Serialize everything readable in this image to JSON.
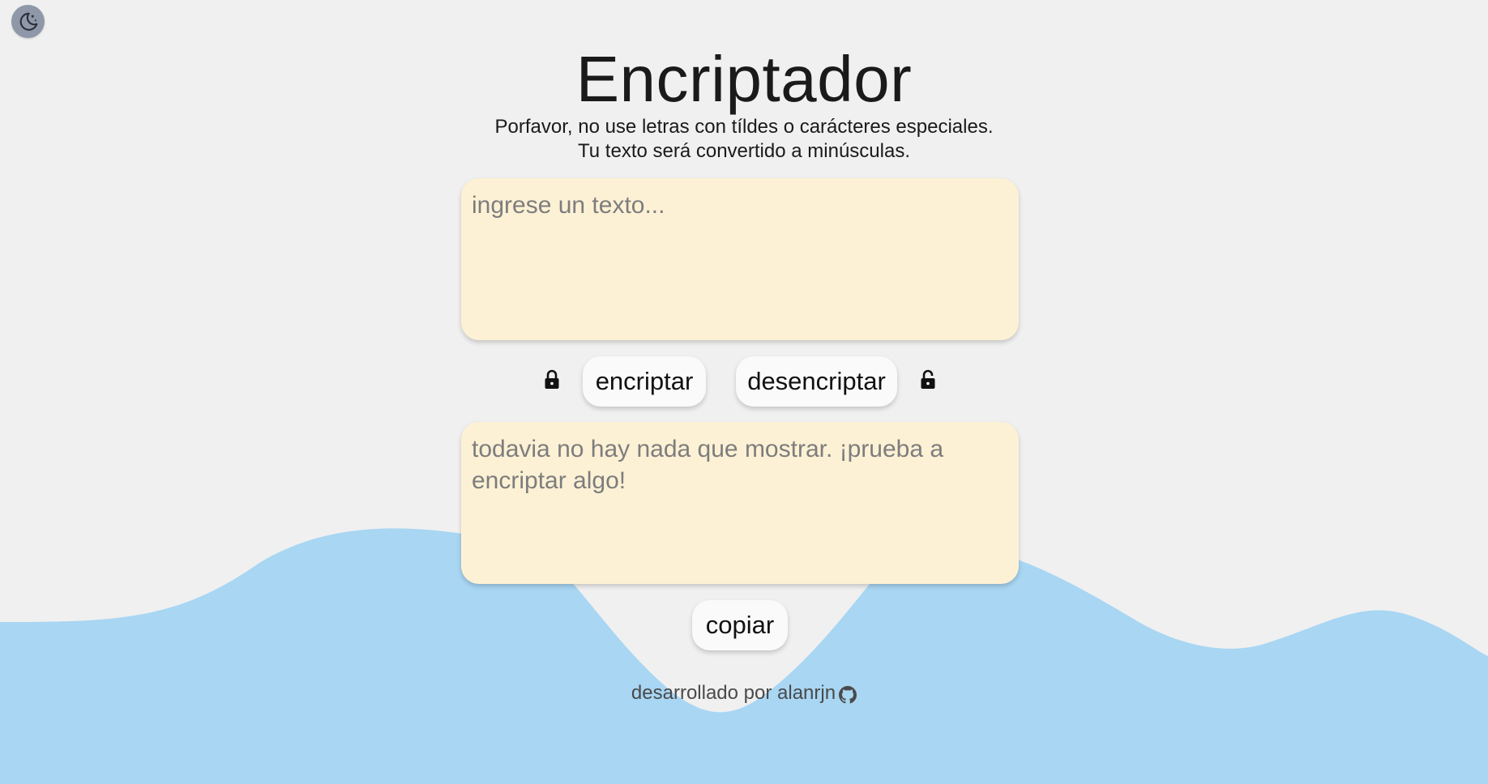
{
  "theme_toggle": {
    "icon": "moon-stars-icon"
  },
  "header": {
    "title": "Encriptador",
    "subtitle_line1": "Porfavor, no use letras con tíldes o carácteres especiales.",
    "subtitle_line2": "Tu texto será convertido a minúsculas."
  },
  "input": {
    "value": "",
    "placeholder": "ingrese un texto..."
  },
  "actions": {
    "encrypt_label": "encriptar",
    "decrypt_label": "desencriptar",
    "encrypt_icon": "lock-icon",
    "decrypt_icon": "unlock-icon"
  },
  "output": {
    "value": "",
    "placeholder": "todavia no hay nada que mostrar. ¡prueba a encriptar algo!"
  },
  "copy": {
    "label": "copiar"
  },
  "footer": {
    "text": "desarrollado por",
    "author": "alanrjn",
    "icon": "github-icon"
  },
  "colors": {
    "background": "#f0f0f0",
    "wave": "#a8d6f3",
    "textbox": "#fdf1d5",
    "button": "#fafafa",
    "toggle": "#8e98a8"
  }
}
